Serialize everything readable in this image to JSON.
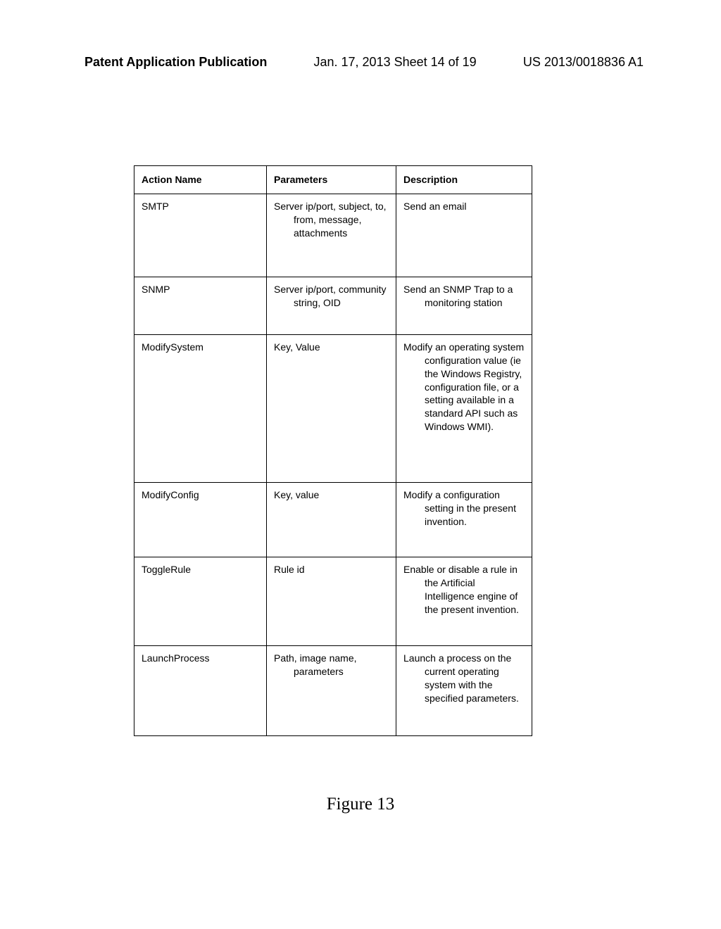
{
  "header": {
    "left": "Patent Application Publication",
    "center": "Jan. 17, 2013  Sheet 14 of 19",
    "right": "US 2013/0018836 A1"
  },
  "table": {
    "columns": [
      "Action Name",
      "Parameters",
      "Description"
    ],
    "rows": [
      {
        "action": "SMTP",
        "params": "Server ip/port, subject, to, from, message, attachments",
        "desc": "Send an email"
      },
      {
        "action": "SNMP",
        "params": "Server ip/port, community string, OID",
        "desc": "Send an SNMP Trap to a monitoring station"
      },
      {
        "action": "ModifySystem",
        "params": "Key, Value",
        "desc": "Modify an operating system configuration value (ie the Windows Registry, configuration file, or a setting available in a standard API such as Windows WMI)."
      },
      {
        "action": "ModifyConfig",
        "params": "Key, value",
        "desc": "Modify a configuration setting in the present invention."
      },
      {
        "action": "ToggleRule",
        "params": "Rule id",
        "desc": "Enable or disable a rule in the Artificial Intelligence engine of the present invention."
      },
      {
        "action": "LaunchProcess",
        "params": "Path, image name, parameters",
        "desc": "Launch a process on the current operating system with the specified parameters."
      }
    ]
  },
  "figure_caption": "Figure 13"
}
